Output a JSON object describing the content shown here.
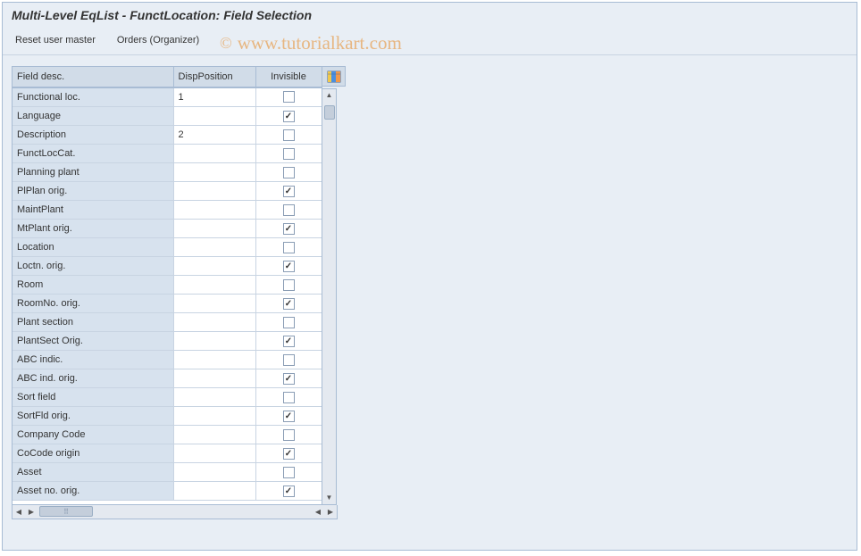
{
  "title": "Multi-Level EqList - FunctLocation: Field Selection",
  "toolbar": {
    "reset_user_master": "Reset user master",
    "orders_organizer": "Orders (Organizer)"
  },
  "watermark": "www.tutorialkart.com",
  "columns": {
    "field_desc": "Field desc.",
    "disp_position": "DispPosition",
    "invisible": "Invisible"
  },
  "rows": [
    {
      "desc": "Functional loc.",
      "disp": "1",
      "invisible": false
    },
    {
      "desc": "Language",
      "disp": "",
      "invisible": true
    },
    {
      "desc": "Description",
      "disp": "2",
      "invisible": false
    },
    {
      "desc": "FunctLocCat.",
      "disp": "",
      "invisible": false
    },
    {
      "desc": "Planning plant",
      "disp": "",
      "invisible": false
    },
    {
      "desc": "PlPlan orig.",
      "disp": "",
      "invisible": true
    },
    {
      "desc": "MaintPlant",
      "disp": "",
      "invisible": false
    },
    {
      "desc": "MtPlant orig.",
      "disp": "",
      "invisible": true
    },
    {
      "desc": "Location",
      "disp": "",
      "invisible": false
    },
    {
      "desc": "Loctn. orig.",
      "disp": "",
      "invisible": true
    },
    {
      "desc": "Room",
      "disp": "",
      "invisible": false
    },
    {
      "desc": "RoomNo. orig.",
      "disp": "",
      "invisible": true
    },
    {
      "desc": "Plant section",
      "disp": "",
      "invisible": false
    },
    {
      "desc": "PlantSect Orig.",
      "disp": "",
      "invisible": true
    },
    {
      "desc": "ABC indic.",
      "disp": "",
      "invisible": false
    },
    {
      "desc": "ABC ind. orig.",
      "disp": "",
      "invisible": true
    },
    {
      "desc": "Sort field",
      "disp": "",
      "invisible": false
    },
    {
      "desc": "SortFld orig.",
      "disp": "",
      "invisible": true
    },
    {
      "desc": "Company Code",
      "disp": "",
      "invisible": false
    },
    {
      "desc": "CoCode origin",
      "disp": "",
      "invisible": true
    },
    {
      "desc": "Asset",
      "disp": "",
      "invisible": false
    },
    {
      "desc": "Asset no. orig.",
      "disp": "",
      "invisible": true
    }
  ]
}
